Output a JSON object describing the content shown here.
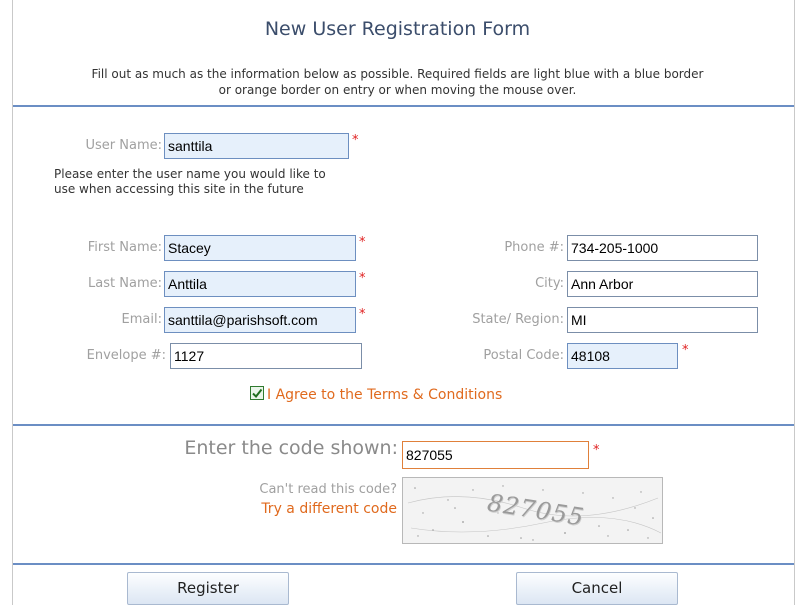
{
  "form": {
    "title": "New User Registration Form",
    "instructions_line1": "Fill out as much as the information below as possible. Required fields are light blue with a blue border",
    "instructions_line2": "or orange border on entry or when moving the mouse over."
  },
  "fields": {
    "username": {
      "label": "User Name:",
      "value": "santtila",
      "required_mark": "*"
    },
    "username_help": "Please enter the user name you would like to use when accessing this site in the future",
    "first_name": {
      "label": "First Name:",
      "value": "Stacey",
      "required_mark": "*"
    },
    "last_name": {
      "label": "Last Name:",
      "value": "Anttila",
      "required_mark": "*"
    },
    "email": {
      "label": "Email:",
      "value": "santtila@parishsoft.com",
      "required_mark": "*"
    },
    "envelope": {
      "label": "Envelope #:",
      "value": "1127"
    },
    "phone": {
      "label": "Phone #:",
      "value": "734-205-1000"
    },
    "city": {
      "label": "City:",
      "value": "Ann Arbor"
    },
    "state": {
      "label": "State/ Region:",
      "value": "MI"
    },
    "postal": {
      "label": "Postal Code:",
      "value": "48108",
      "required_mark": "*"
    }
  },
  "terms": {
    "checked": true,
    "label": "I Agree to the Terms & Conditions"
  },
  "captcha": {
    "label": "Enter the code shown:",
    "value": "827055",
    "required_mark": "*",
    "cant_read": "Can't read this code?",
    "try_different": "Try a different code",
    "image_text": "827055"
  },
  "buttons": {
    "register": "Register",
    "cancel": "Cancel"
  },
  "colors": {
    "accent_orange": "#e06a1e",
    "required_bg": "#e6f0fb",
    "rule_blue": "#6b8ec4",
    "required_star": "#e02020"
  }
}
